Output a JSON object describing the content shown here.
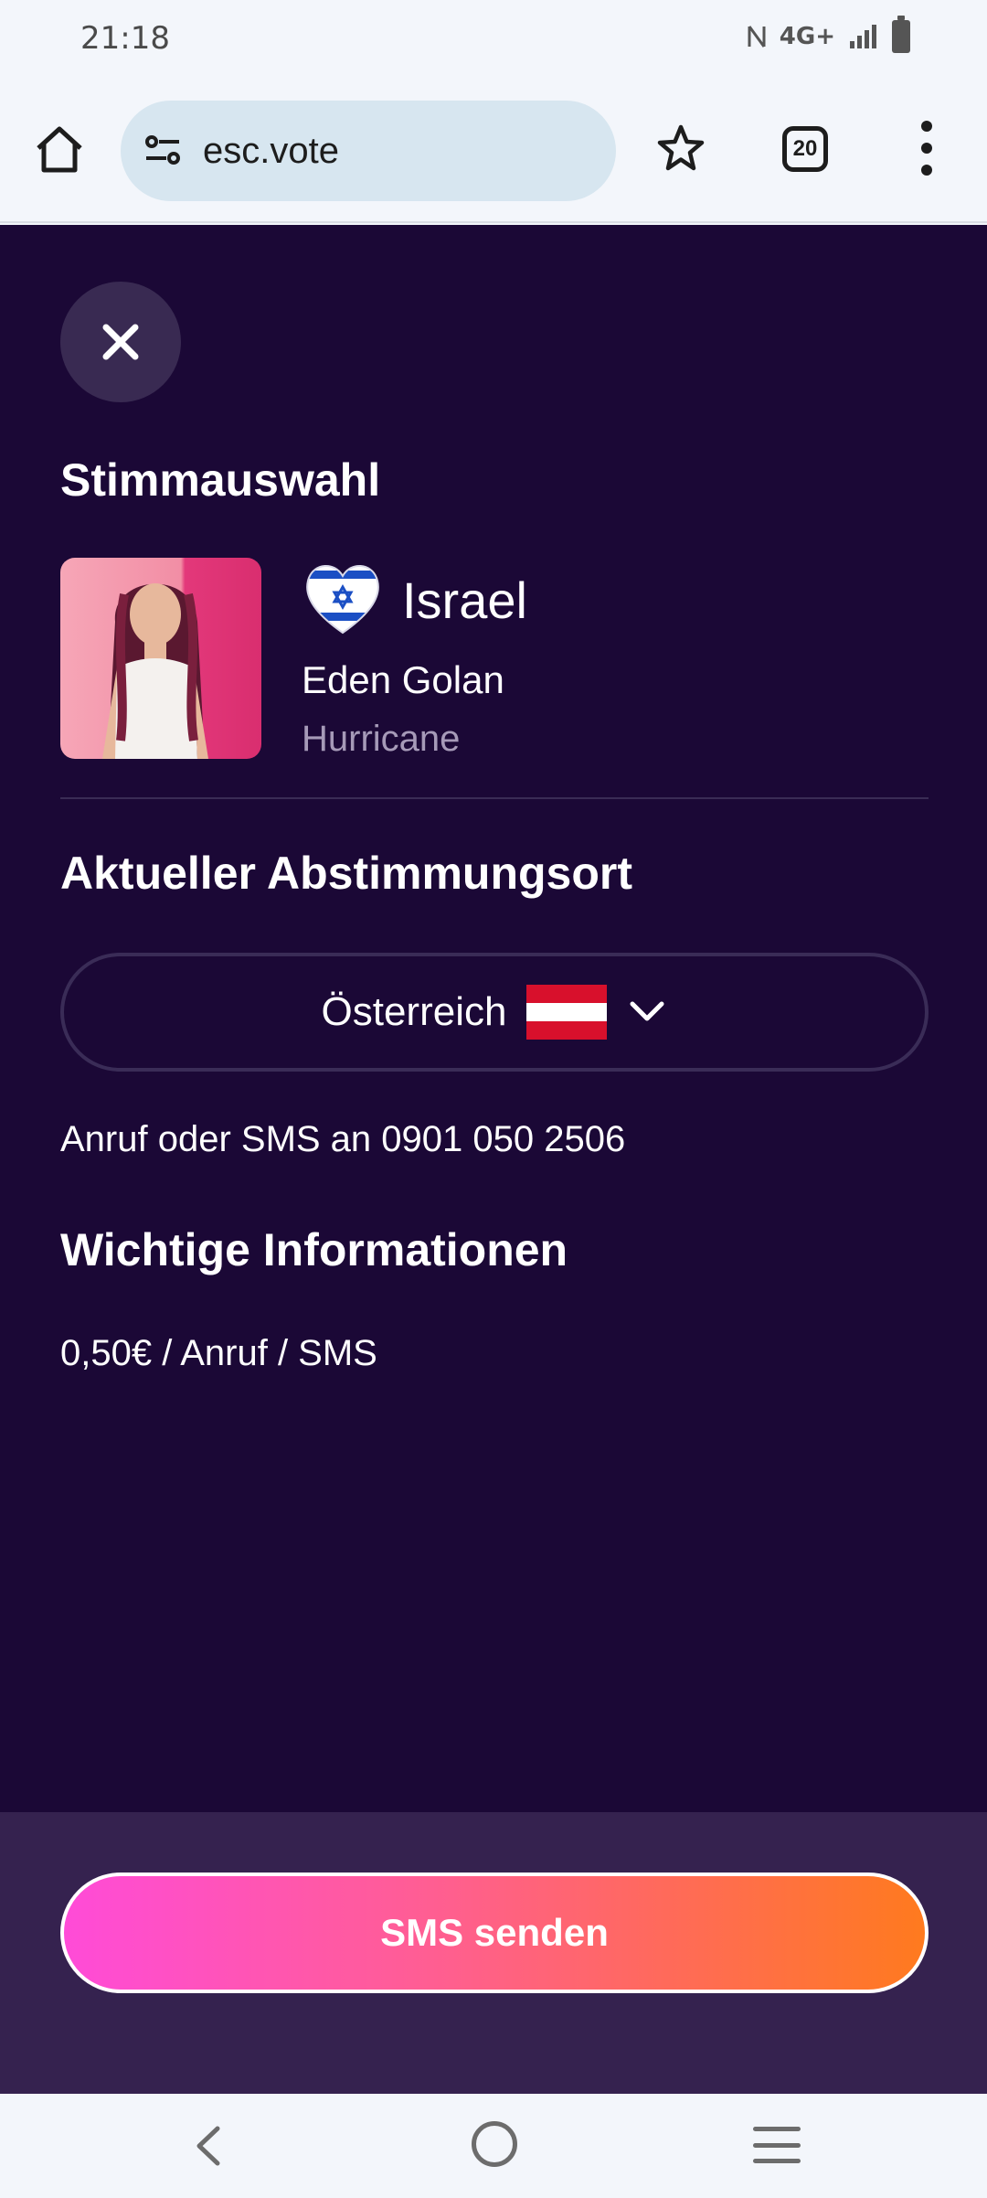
{
  "status_bar": {
    "time": "21:18",
    "network": "4G+"
  },
  "browser": {
    "url": "esc.vote",
    "tab_count": "20"
  },
  "vote": {
    "title": "Stimmauswahl",
    "country": "Israel",
    "artist": "Eden Golan",
    "song": "Hurricane"
  },
  "location": {
    "title": "Aktueller Abstimmungsort",
    "selected_country": "Österreich",
    "vote_text": "Anruf oder SMS an 0901 050 2506"
  },
  "info": {
    "title": "Wichtige Informationen",
    "price": "0,50€ / Anruf / SMS"
  },
  "action": {
    "button_label": "SMS senden"
  },
  "colors": {
    "page_bg": "#1b0836",
    "footer_bg": "#35224f",
    "gradient_start": "#ff4bd8",
    "gradient_end": "#ff7a1e"
  }
}
